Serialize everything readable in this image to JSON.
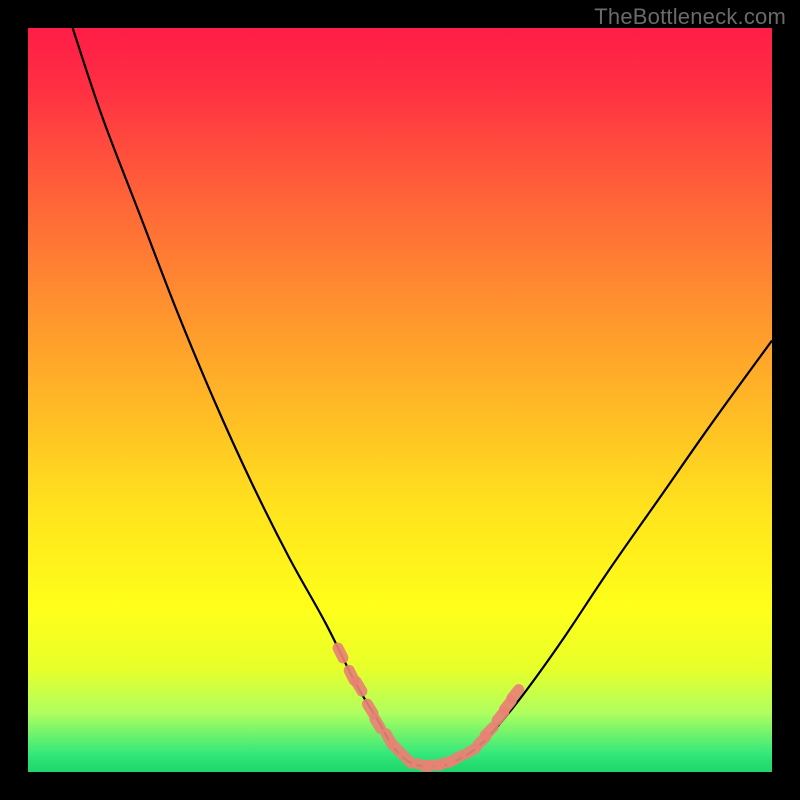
{
  "watermark": "TheBottleneck.com",
  "colors": {
    "frame": "#000000",
    "curve": "#000000",
    "marker": "#e88274",
    "gradient_stops": [
      {
        "offset": 0.0,
        "color": "#ff1d47"
      },
      {
        "offset": 0.08,
        "color": "#ff2f43"
      },
      {
        "offset": 0.2,
        "color": "#ff5a3a"
      },
      {
        "offset": 0.35,
        "color": "#ff8a30"
      },
      {
        "offset": 0.5,
        "color": "#ffb726"
      },
      {
        "offset": 0.65,
        "color": "#ffe41d"
      },
      {
        "offset": 0.78,
        "color": "#ffff1a"
      },
      {
        "offset": 0.86,
        "color": "#e8ff2a"
      },
      {
        "offset": 0.92,
        "color": "#b0ff5e"
      },
      {
        "offset": 0.975,
        "color": "#35e87a"
      },
      {
        "offset": 1.0,
        "color": "#1dd66c"
      }
    ]
  },
  "chart_data": {
    "type": "line",
    "title": "",
    "xlabel": "",
    "ylabel": "",
    "xlim": [
      0,
      100
    ],
    "ylim": [
      0,
      100
    ],
    "grid": false,
    "series": [
      {
        "name": "bottleneck-curve",
        "x": [
          6,
          10,
          15,
          20,
          25,
          30,
          35,
          40,
          44,
          47,
          49,
          51,
          53,
          55,
          57,
          60,
          63,
          67,
          72,
          78,
          85,
          92,
          100
        ],
        "y": [
          100,
          88,
          75,
          62,
          50,
          39,
          29,
          20,
          12,
          7,
          3.5,
          1.5,
          0.8,
          0.8,
          1.3,
          3.0,
          6,
          11,
          18,
          27,
          37,
          47,
          58
        ]
      }
    ],
    "markers": {
      "name": "highlighted-points",
      "x": [
        42.0,
        43.5,
        44.5,
        46.0,
        47.0,
        48.5,
        49.5,
        51.0,
        53.0,
        54.5,
        56.0,
        57.5,
        59.5,
        61.0,
        62.0,
        63.5,
        64.5,
        65.5
      ],
      "y": [
        16.0,
        13.0,
        11.5,
        8.5,
        6.5,
        4.5,
        3.2,
        1.7,
        0.9,
        0.9,
        1.2,
        1.8,
        2.8,
        4.2,
        5.5,
        7.5,
        9.0,
        10.5
      ]
    }
  }
}
